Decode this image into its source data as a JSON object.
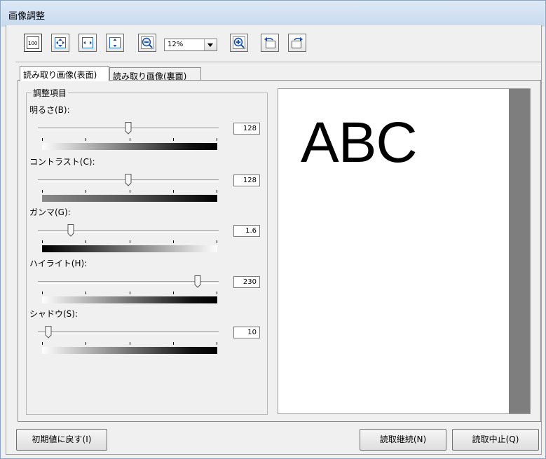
{
  "window": {
    "title": "画像調整"
  },
  "toolbar": {
    "zoom_value": "12%"
  },
  "tabs": [
    {
      "label": "読み取り画像(表面)",
      "active": true
    },
    {
      "label": "読み取り画像(裏面)",
      "active": false
    }
  ],
  "group": {
    "title": "調整項目"
  },
  "sliders": [
    {
      "label": "明るさ(B):",
      "value": "128",
      "level": 0.5,
      "gradient": "light-to-dark"
    },
    {
      "label": "コントラスト(C):",
      "value": "128",
      "level": 0.5,
      "gradient": "gray-to-dark"
    },
    {
      "label": "ガンマ(G):",
      "value": "1.6",
      "level": 0.17,
      "gradient": "dark-to-light"
    },
    {
      "label": "ハイライト(H):",
      "value": "230",
      "level": 0.9,
      "gradient": "light-to-dark"
    },
    {
      "label": "シャドウ(S):",
      "value": "10",
      "level": 0.04,
      "gradient": "light-to-dark"
    }
  ],
  "preview": {
    "text": "ABC"
  },
  "buttons": {
    "reset": "初期値に戻す(I)",
    "continue": "読取継続(N)",
    "cancel": "読取中止(Q)"
  }
}
